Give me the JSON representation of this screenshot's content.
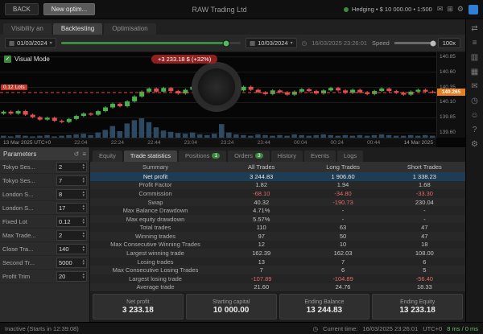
{
  "topbar": {
    "back": "BACK",
    "new_button": "New optim...",
    "title": "RAW Trading Ltd",
    "account_text": "Hedging   •   $ 10 000.00   •   1:500",
    "icons": [
      {
        "name": "mail-icon",
        "glyph": "✉"
      },
      {
        "name": "apps-grid-icon",
        "glyph": "⊞"
      },
      {
        "name": "settings-icon",
        "glyph": "⚙"
      }
    ]
  },
  "main_tabs": {
    "chart": "Visibility an",
    "backtesting": "Backtesting",
    "optimisation": "Optimisation"
  },
  "controlbar": {
    "start_date": "01/03/2024",
    "end_date": "10/03/2024",
    "current_time": "16/03/2025 23:26:01",
    "speed_label": "Speed",
    "speed_value": "100x"
  },
  "chart": {
    "visual_mode_label": "Visual Mode",
    "annotation": "+3 233.18 $ (+32%)",
    "position_tag": "0.12 Lots",
    "current_price": "140.265",
    "date_label": "13 Mar 2025 UTC+0",
    "time_labels": [
      "22:04",
      "22:24",
      "22:44",
      "23:04",
      "23:24",
      "23:44",
      "00:04",
      "00:24",
      "00:44"
    ],
    "end_date_label": "14 Mar 2025",
    "price_labels": [
      140.85,
      140.6,
      140.35,
      140.1,
      139.85,
      139.6
    ],
    "closes": [
      139.95,
      139.92,
      139.96,
      139.9,
      139.86,
      139.82,
      139.85,
      139.8,
      139.78,
      139.83,
      139.88,
      139.92,
      139.9,
      139.96,
      140.02,
      140.08,
      140.04,
      140.12,
      140.2,
      140.28,
      140.33,
      140.28,
      140.34,
      140.29,
      140.25,
      140.31,
      140.36,
      140.32,
      140.28,
      140.34,
      140.39,
      140.34,
      140.3,
      140.36,
      140.31,
      140.27,
      140.24,
      140.3,
      140.27,
      140.23,
      140.28,
      140.32,
      140.29,
      140.25,
      140.3,
      140.34,
      140.3,
      140.26,
      140.31,
      140.27,
      140.24,
      140.29,
      140.33,
      140.29,
      140.26,
      140.23,
      140.28,
      140.31,
      140.28,
      140.27
    ],
    "volumes": [
      3,
      2,
      4,
      3,
      2,
      3,
      4,
      2,
      3,
      4,
      5,
      6,
      4,
      8,
      12,
      18,
      10,
      22,
      27,
      30,
      24,
      16,
      11,
      9,
      7,
      6,
      8,
      5,
      4,
      6,
      21,
      8,
      5,
      4,
      3,
      5,
      4,
      3,
      4,
      3,
      5,
      4,
      3,
      4,
      5,
      4,
      3,
      4,
      3,
      4,
      3,
      4,
      5,
      4,
      3,
      3,
      4,
      3,
      4,
      3
    ]
  },
  "parameters": {
    "title": "Parameters",
    "items": [
      {
        "label": "Tokyo Ses...",
        "value": "2"
      },
      {
        "label": "Tokyo Ses...",
        "value": "7"
      },
      {
        "label": "London S...",
        "value": "8"
      },
      {
        "label": "London S...",
        "value": "17"
      },
      {
        "label": "Fixed Lot",
        "value": "0.12"
      },
      {
        "label": "Max Trade...",
        "value": "2"
      },
      {
        "label": "Close Tra...",
        "value": "140"
      },
      {
        "label": "Second Tr...",
        "value": "5000"
      },
      {
        "label": "Profit Trim",
        "value": "20"
      }
    ]
  },
  "stats_tabs": [
    {
      "label": "Equity"
    },
    {
      "label": "Trade statistics",
      "active": true
    },
    {
      "label": "Positions",
      "badge": "1"
    },
    {
      "label": "Orders",
      "badge": "3"
    },
    {
      "label": "History"
    },
    {
      "label": "Events"
    },
    {
      "label": "Logs"
    }
  ],
  "statistics": {
    "headers": [
      "Summary",
      "All Trades",
      "Long Trades",
      "Short Trades"
    ],
    "selected_row": 0,
    "rows": [
      [
        "Net profit",
        "3 244.83",
        "1 906.60",
        "1 338.23"
      ],
      [
        "Profit Factor",
        "1.82",
        "1.94",
        "1.68"
      ],
      [
        "Commission",
        "-68.10",
        "-34.80",
        "-33.30"
      ],
      [
        "Swap",
        "40.32",
        "-190.73",
        "230.04"
      ],
      [
        "Max Balance Drawdown",
        "4.71%",
        "-",
        "-"
      ],
      [
        "Max equity drawdown",
        "5.57%",
        "-",
        "-"
      ],
      [
        "Total trades",
        "110",
        "63",
        "47"
      ],
      [
        "Winning trades",
        "97",
        "50",
        "47"
      ],
      [
        "Max Consecutive Winning Trades",
        "12",
        "10",
        "18"
      ],
      [
        "Largest winning trade",
        "162.39",
        "162.03",
        "108.00"
      ],
      [
        "Losing trades",
        "13",
        "7",
        "6"
      ],
      [
        "Max Consecutive Losing Trades",
        "7",
        "6",
        "5"
      ],
      [
        "Largest losing trade",
        "-107.89",
        "-104.89",
        "-56.40"
      ],
      [
        "Average trade",
        "21.60",
        "24.76",
        "18.33"
      ]
    ]
  },
  "summary_cards": [
    {
      "label": "Net profit",
      "value": "3 233.18"
    },
    {
      "label": "Starting capital",
      "value": "10 000.00"
    },
    {
      "label": "Ending Balance",
      "value": "13 244.83"
    },
    {
      "label": "Ending Equity",
      "value": "13 233.18"
    }
  ],
  "toolbar_icons": [
    {
      "name": "trade-icon",
      "glyph": "⇄"
    },
    {
      "name": "watchlist-icon",
      "glyph": "≡"
    },
    {
      "name": "chart-icon",
      "glyph": "▥"
    },
    {
      "name": "calendar-icon",
      "glyph": "▦"
    },
    {
      "name": "news-icon",
      "glyph": "✉"
    },
    {
      "name": "alerts-icon",
      "glyph": "◷"
    },
    {
      "name": "community-icon",
      "glyph": "☺"
    },
    {
      "name": "help-icon",
      "glyph": "?"
    },
    {
      "name": "settings-icon",
      "glyph": "⚙"
    }
  ],
  "statusbar": {
    "status": "Inactive (Starts in 12:39:08)",
    "current_time_label": "Current time:",
    "current_time": "16/03/2025 23:26:01",
    "timezone": "UTC+0",
    "latency": "8 ms / 0 ms"
  },
  "colors": {
    "accent_green": "#3d8b40",
    "loss_red": "#e06c6c",
    "candle_up": "#4caf50",
    "candle_down": "#e05050",
    "price_tag_orange": "#e67e22"
  }
}
